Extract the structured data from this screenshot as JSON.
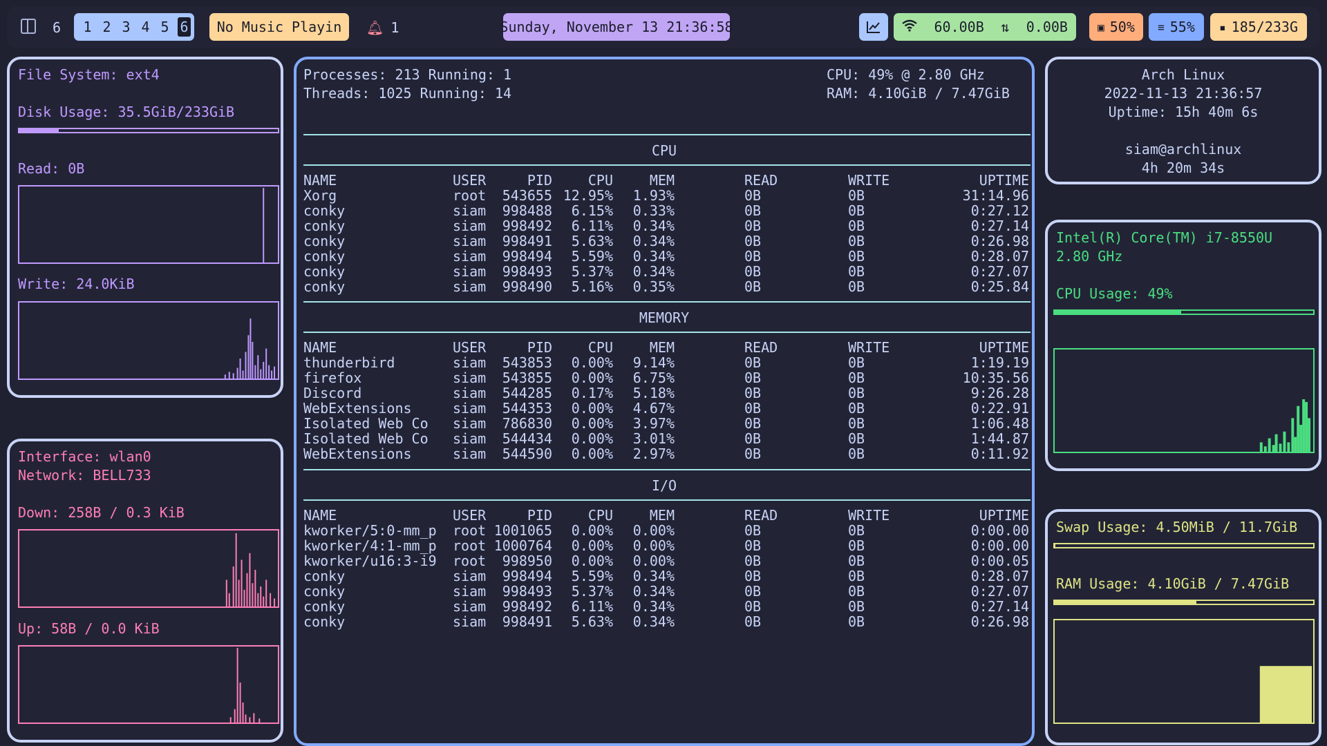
{
  "topbar": {
    "layout_icon": "layout-split-icon",
    "window_count": "6",
    "workspaces": [
      "1",
      "2",
      "3",
      "4",
      "5",
      "6"
    ],
    "active_workspace": "6",
    "music": "No Music Playin",
    "notifications": {
      "icon": "bell-icon",
      "count": "1"
    },
    "clock": "Sunday, November 13 21:36:58",
    "network": {
      "download": "60.00B",
      "upload": "0.00B"
    },
    "cpu": "50%",
    "memory": "55%",
    "disk": "185/233G"
  },
  "filesystem": {
    "type_line": "File System: ext4",
    "disk_line": "Disk Usage: 35.5GiB/233GiB",
    "disk_usage_fraction": 0.152,
    "read_line": "Read: 0B",
    "write_line": "Write: 24.0KiB",
    "color": "#c099ff"
  },
  "network": {
    "interface_line": "Interface: wlan0",
    "network_line": "Network: BELL733",
    "down_line": "Down: 258B / 0.3 KiB",
    "up_line": "Up: 58B / 0.0 KiB",
    "color": "#ff7eb6"
  },
  "main": {
    "summary": {
      "processes": "Processes: 213 Running: 1",
      "threads": "Threads: 1025 Running: 14",
      "cpu": "CPU: 49% @ 2.80 GHz",
      "ram": "RAM: 4.10GiB / 7.47GiB"
    },
    "columns": [
      "NAME",
      "USER",
      "PID",
      "CPU",
      "MEM",
      "READ",
      "WRITE",
      "UPTIME"
    ],
    "sections": [
      {
        "title": "CPU",
        "rows": [
          [
            "Xorg",
            "root",
            "543655",
            "12.95%",
            "1.93%",
            "0B",
            "0B",
            "31:14.96"
          ],
          [
            "conky",
            "siam",
            "998488",
            "6.15%",
            "0.33%",
            "0B",
            "0B",
            "0:27.12"
          ],
          [
            "conky",
            "siam",
            "998492",
            "6.11%",
            "0.34%",
            "0B",
            "0B",
            "0:27.14"
          ],
          [
            "conky",
            "siam",
            "998491",
            "5.63%",
            "0.34%",
            "0B",
            "0B",
            "0:26.98"
          ],
          [
            "conky",
            "siam",
            "998494",
            "5.59%",
            "0.34%",
            "0B",
            "0B",
            "0:28.07"
          ],
          [
            "conky",
            "siam",
            "998493",
            "5.37%",
            "0.34%",
            "0B",
            "0B",
            "0:27.07"
          ],
          [
            "conky",
            "siam",
            "998490",
            "5.16%",
            "0.35%",
            "0B",
            "0B",
            "0:25.84"
          ]
        ]
      },
      {
        "title": "MEMORY",
        "rows": [
          [
            "thunderbird",
            "siam",
            "543853",
            "0.00%",
            "9.14%",
            "0B",
            "0B",
            "1:19.19"
          ],
          [
            "firefox",
            "siam",
            "543855",
            "0.00%",
            "6.75%",
            "0B",
            "0B",
            "10:35.56"
          ],
          [
            "Discord",
            "siam",
            "544285",
            "0.17%",
            "5.18%",
            "0B",
            "0B",
            "9:26.28"
          ],
          [
            "WebExtensions",
            "siam",
            "544353",
            "0.00%",
            "4.67%",
            "0B",
            "0B",
            "0:22.91"
          ],
          [
            "Isolated Web Co",
            "siam",
            "786830",
            "0.00%",
            "3.97%",
            "0B",
            "0B",
            "1:06.48"
          ],
          [
            "Isolated Web Co",
            "siam",
            "544434",
            "0.00%",
            "3.01%",
            "0B",
            "0B",
            "1:44.87"
          ],
          [
            "WebExtensions",
            "siam",
            "544590",
            "0.00%",
            "2.97%",
            "0B",
            "0B",
            "0:11.92"
          ]
        ]
      },
      {
        "title": "I/O",
        "rows": [
          [
            "kworker/5:0-mm_p",
            "root",
            "1001065",
            "0.00%",
            "0.00%",
            "0B",
            "0B",
            "0:00.00"
          ],
          [
            "kworker/4:1-mm_p",
            "root",
            "1000764",
            "0.00%",
            "0.00%",
            "0B",
            "0B",
            "0:00.00"
          ],
          [
            "kworker/u16:3-i9",
            "root",
            "998950",
            "0.00%",
            "0.00%",
            "0B",
            "0B",
            "0:00.05"
          ],
          [
            "conky",
            "siam",
            "998494",
            "5.59%",
            "0.34%",
            "0B",
            "0B",
            "0:28.07"
          ],
          [
            "conky",
            "siam",
            "998493",
            "5.37%",
            "0.34%",
            "0B",
            "0B",
            "0:27.07"
          ],
          [
            "conky",
            "siam",
            "998492",
            "6.11%",
            "0.34%",
            "0B",
            "0B",
            "0:27.14"
          ],
          [
            "conky",
            "siam",
            "998491",
            "5.63%",
            "0.34%",
            "0B",
            "0B",
            "0:26.98"
          ]
        ]
      }
    ]
  },
  "system": {
    "os": "Arch Linux",
    "datetime": "2022-11-13 21:36:57",
    "uptime": "Uptime: 15h 40m 6s",
    "user": "siam@archlinux",
    "session": "4h 20m 34s"
  },
  "cpu": {
    "model": "Intel(R) Core(TM) i7-8550U",
    "freq": "2.80 GHz",
    "usage_line": "CPU Usage: 49%",
    "usage_fraction": 0.49,
    "color": "#4ade80"
  },
  "memory": {
    "swap_line": "Swap Usage: 4.50MiB / 11.7GiB",
    "swap_fraction": 0.0004,
    "ram_line": "RAM Usage: 4.10GiB / 7.47GiB",
    "ram_fraction": 0.549,
    "color": "#e0e484"
  }
}
